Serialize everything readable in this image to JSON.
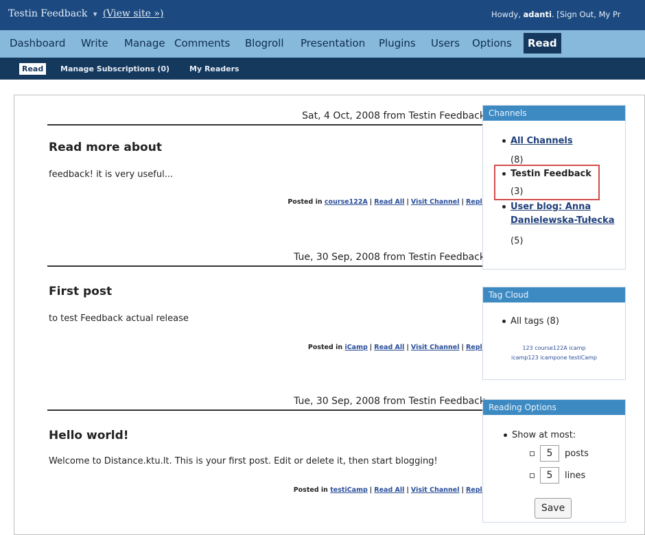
{
  "header": {
    "site_title": "Testin Feedback",
    "arrow": "▾",
    "view_site": "(View site »)",
    "howdy_prefix": "Howdy, ",
    "username": "adanti",
    "account_links": ". [Sign Out, My Pr"
  },
  "main_menu": {
    "items": [
      "Dashboard",
      "Write",
      "Manage",
      "Comments",
      "Blogroll",
      "Presentation",
      "Plugins",
      "Users",
      "Options",
      "Read"
    ],
    "active": "Read"
  },
  "sub_menu": {
    "items": [
      "Read",
      "Manage Subscriptions (0)",
      "My Readers"
    ],
    "active": "Read"
  },
  "posts": [
    {
      "date_line": "Sat, 4 Oct, 2008 from Testin Feedback",
      "title": "Read more about",
      "body": "feedback! it is very useful...",
      "posted_in_label": "Posted in",
      "category": "course122A",
      "read_all": "Read All",
      "visit_channel": "Visit Channel",
      "reply": "Reply"
    },
    {
      "date_line": "Tue, 30 Sep, 2008 from Testin Feedback",
      "title": "First post",
      "body": "to test Feedback actual release",
      "posted_in_label": "Posted in",
      "category": "iCamp",
      "read_all": "Read All",
      "visit_channel": "Visit Channel",
      "reply": "Reply"
    },
    {
      "date_line": "Tue, 30 Sep, 2008 from Testin Feedback",
      "title": "Hello world!",
      "body": "Welcome to Distance.ktu.lt. This is your first post. Edit or delete it, then start blogging!",
      "posted_in_label": "Posted in",
      "category": "testiCamp",
      "read_all": "Read All",
      "visit_channel": "Visit Channel",
      "reply": "Reply"
    }
  ],
  "separator": "|",
  "channels": {
    "header": "Channels",
    "items": [
      {
        "name": "All Channels",
        "count": "(8)"
      },
      {
        "name": "Testin Feedback",
        "count": "(3)"
      },
      {
        "name_line1": "User blog: Anna",
        "name_line2": "Danielewska-Tułecka",
        "count": "(5)"
      }
    ]
  },
  "tag_cloud": {
    "header": "Tag Cloud",
    "all_tags": "All tags (8)",
    "line1": "123 course122A icamp",
    "line2": "icamp123 icampone testiCamp"
  },
  "reading_options": {
    "header": "Reading Options",
    "show_at_most": "Show at most:",
    "posts_value": "5",
    "posts_label": "posts",
    "lines_value": "5",
    "lines_label": "lines",
    "save": "Save"
  },
  "colors": {
    "top_bar": "#1c4a80",
    "main_menu": "#87b9dc",
    "sub_menu": "#15385d",
    "sidebar_header": "#3d8ac3",
    "highlight": "#d24a4a"
  }
}
